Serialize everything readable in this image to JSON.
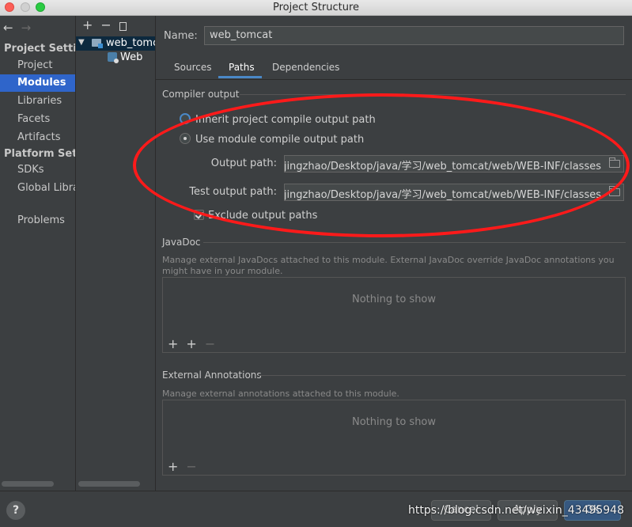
{
  "window": {
    "title": "Project Structure"
  },
  "nav": {
    "back_icon": "arrow-left-icon",
    "forward_icon": "arrow-right-icon",
    "project_settings_header": "Project Settings",
    "project_items": [
      "Project",
      "Modules",
      "Libraries",
      "Facets",
      "Artifacts"
    ],
    "selected_item": "Modules",
    "platform_settings_header": "Platform Settings",
    "platform_items": [
      "SDKs",
      "Global Libraries"
    ],
    "problems": "Problems"
  },
  "tree": {
    "toolbar": {
      "add": "+",
      "remove": "−"
    },
    "root": "web_tomcat",
    "child": "Web"
  },
  "module": {
    "name_label": "Name:",
    "name_value": "web_tomcat",
    "tabs": [
      "Sources",
      "Paths",
      "Dependencies"
    ],
    "active_tab": "Paths"
  },
  "compiler": {
    "title": "Compiler output",
    "inherit_label": "Inherit project compile output path",
    "use_module_label": "Use module compile output path",
    "selected_option": "use_module",
    "output_label": "Output path:",
    "output_value": "/Users/jingzhao/Desktop/java/学习/web_tomcat/web/WEB-INF/classes",
    "test_label": "Test output path:",
    "test_value": "/Users/jingzhao/Desktop/java/学习/web_tomcat/web/WEB-INF/classes",
    "exclude_label": "Exclude output paths",
    "exclude_checked": true
  },
  "javadoc": {
    "title": "JavaDoc",
    "description": "Manage external JavaDocs attached to this module. External JavaDoc override JavaDoc annotations you might have in your module.",
    "empty": "Nothing to show",
    "toolbar": {
      "add": "+",
      "add_url": "+",
      "remove": "−"
    }
  },
  "annotations": {
    "title": "External Annotations",
    "description": "Manage external annotations attached to this module.",
    "empty": "Nothing to show",
    "toolbar": {
      "add": "+",
      "remove": "−"
    }
  },
  "footer": {
    "help": "?",
    "cancel": "Cancel",
    "apply": "Apply",
    "ok": "OK",
    "watermark": "https://blog.csdn.net/weixin_43495948"
  },
  "colors": {
    "selection": "#2f65ca",
    "annotation": "#ff1a1a",
    "accent": "#4a88c7"
  }
}
